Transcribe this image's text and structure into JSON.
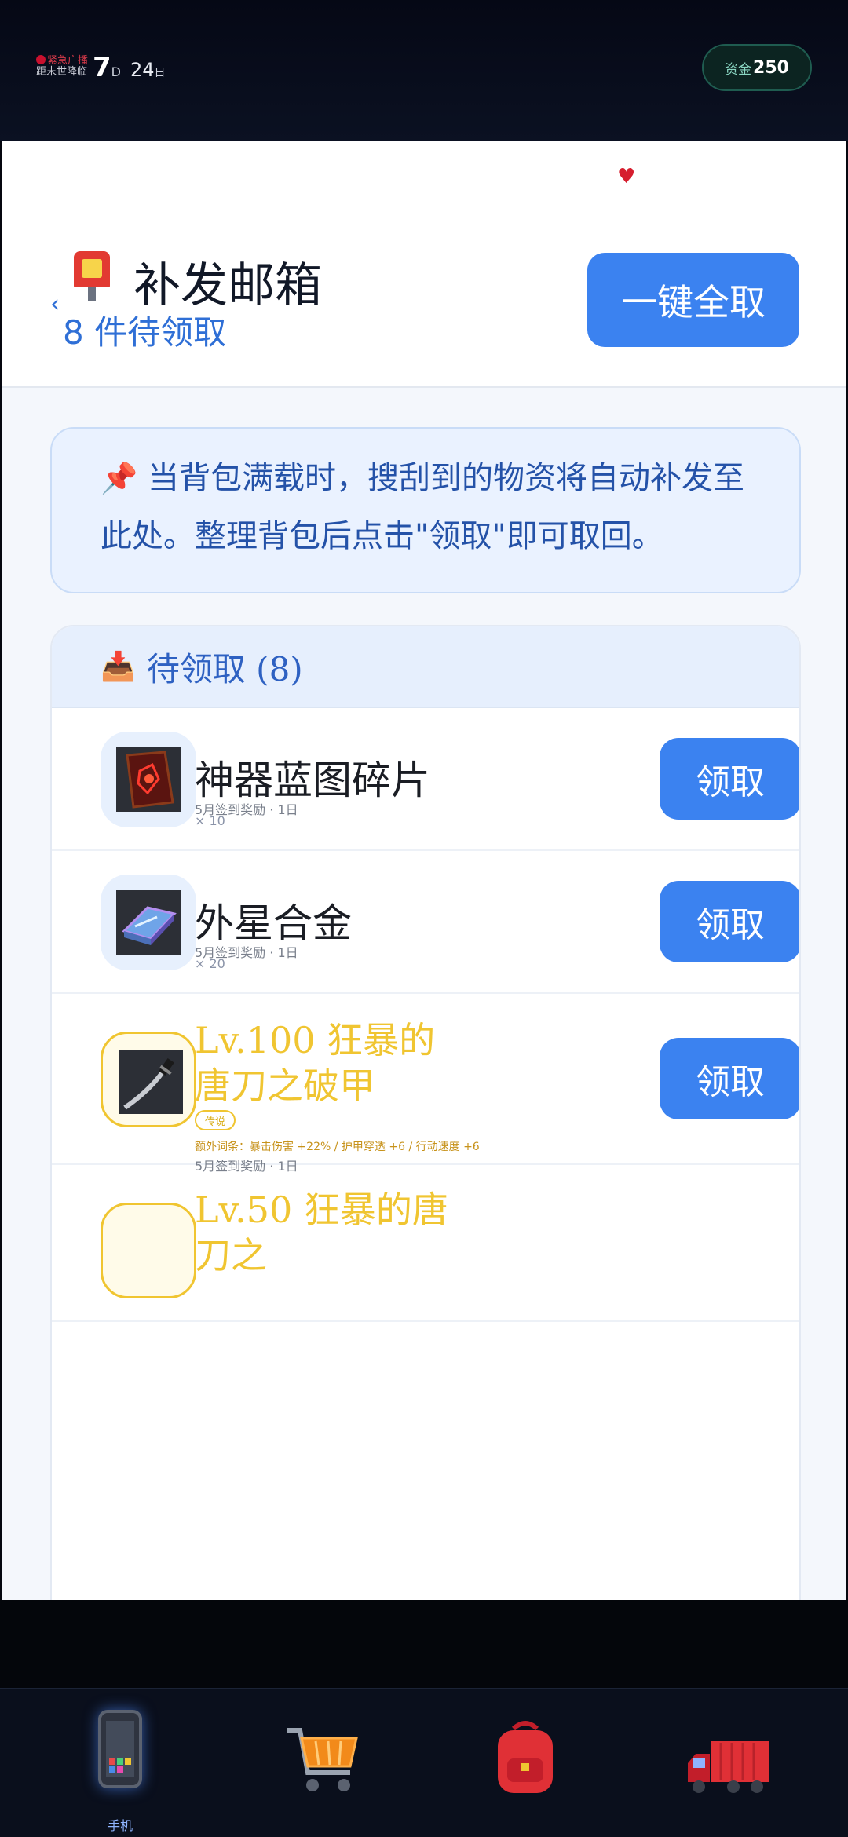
{
  "status_bar": {
    "broadcast_line1": "紧急广播",
    "broadcast_line2": "距末世降临",
    "day_value": "7",
    "day_unit": "D",
    "hour_value": "24",
    "hour_unit": "日",
    "funds_label": "资金",
    "funds_value": "250"
  },
  "header": {
    "title": "补发邮箱",
    "pending_count_text": "8 件待领取",
    "claim_all_label": "一键全取"
  },
  "notice": {
    "text": "当背包满载时，搜刮到的物资将自动补发至此处。整理背包后点击\"领取\"即可取回。"
  },
  "list": {
    "heading": "待领取 (8)",
    "items": [
      {
        "name": "神器蓝图碎片",
        "source": "5月签到奖励 · 1日",
        "quantity": "× 10",
        "claim_label": "领取"
      },
      {
        "name": "外星合金",
        "source": "5月签到奖励 · 1日",
        "quantity": "× 20",
        "claim_label": "领取"
      },
      {
        "name": "Lv.100 狂暴的唐刀之破甲",
        "rarity": "传说",
        "affixes": "额外词条：暴击伤害 +22% / 护甲穿透 +6 / 行动速度 +6",
        "source": "5月签到奖励 · 1日",
        "claim_label": "领取"
      },
      {
        "name": "Lv.50 狂暴的唐刀之"
      }
    ]
  },
  "dock": {
    "phone_label": "手机"
  },
  "colors": {
    "accent_blue": "#3b82f0",
    "legend_gold": "#f0c531",
    "alert_red": "#d61e2e"
  },
  "icons": [
    "broadcast-dot-icon",
    "heart-icon",
    "back-chevron-icon",
    "mailbox-icon",
    "pin-icon",
    "inbox-tray-icon",
    "blueprint-fragment-icon",
    "alien-alloy-icon",
    "tang-sword-icon",
    "phone-icon",
    "shopping-cart-icon",
    "backpack-icon",
    "truck-icon"
  ]
}
